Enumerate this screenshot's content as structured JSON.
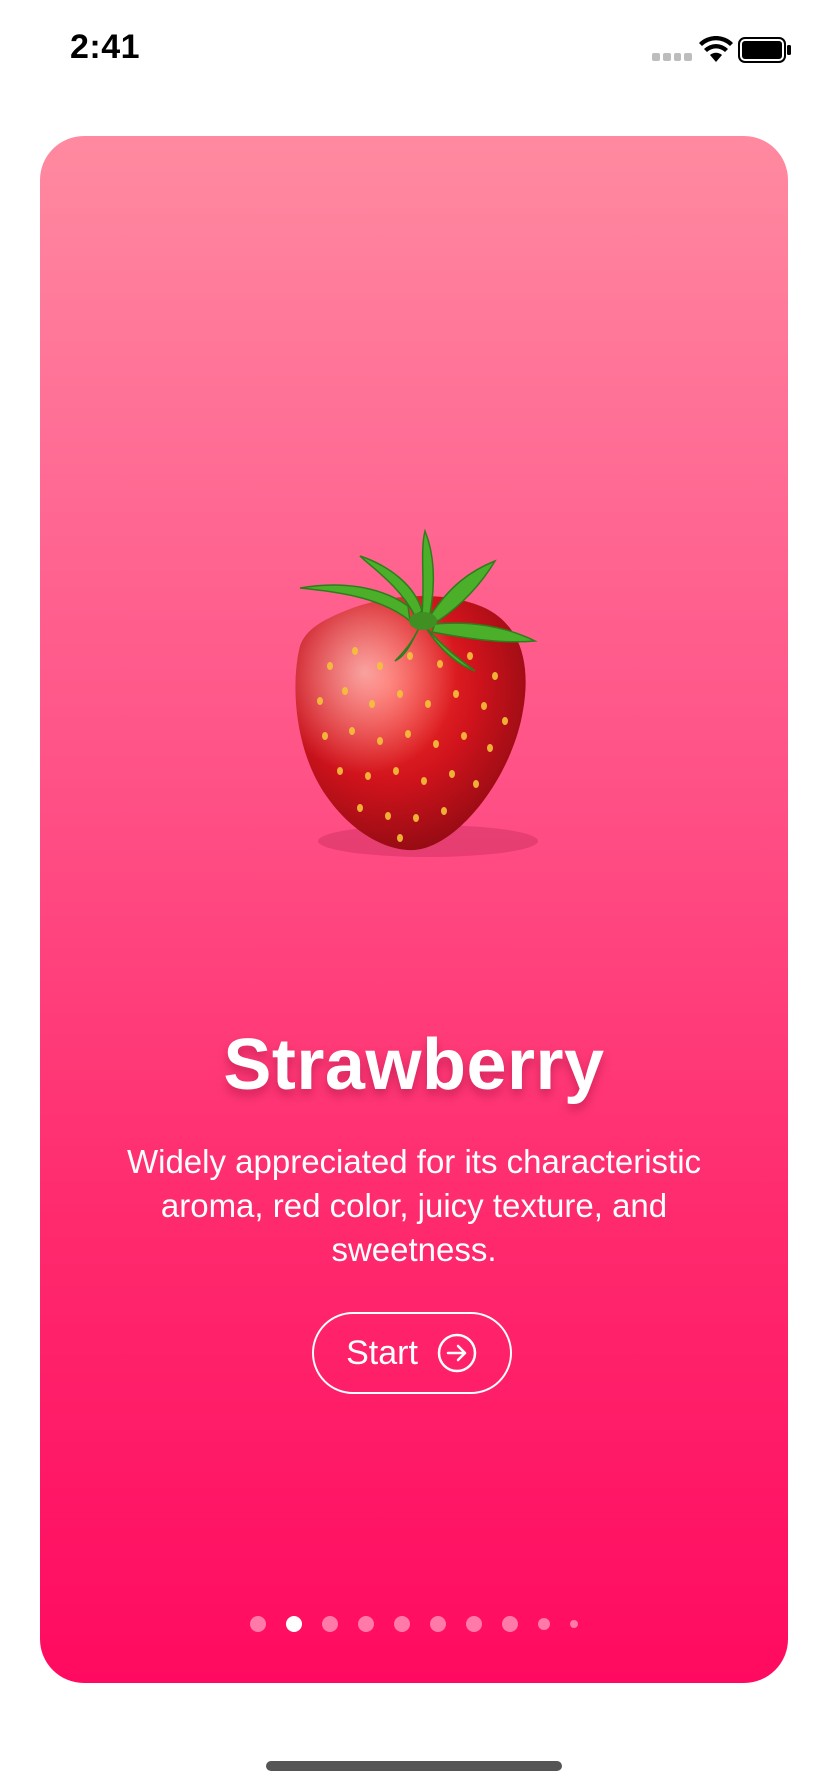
{
  "status_bar": {
    "time": "2:41"
  },
  "card": {
    "image_icon": "strawberry-image",
    "title": "Strawberry",
    "description": "Widely appreciated for its characteristic\naroma,  red color, juicy texture, and\nsweetness.",
    "button_label": "Start",
    "button_icon": "arrow-right-circle-icon",
    "page_count": 10,
    "active_page": 2,
    "colors": {
      "gradient_top": "#ff8aa0",
      "gradient_bottom": "#ff0a60",
      "text": "#ffffff"
    }
  }
}
